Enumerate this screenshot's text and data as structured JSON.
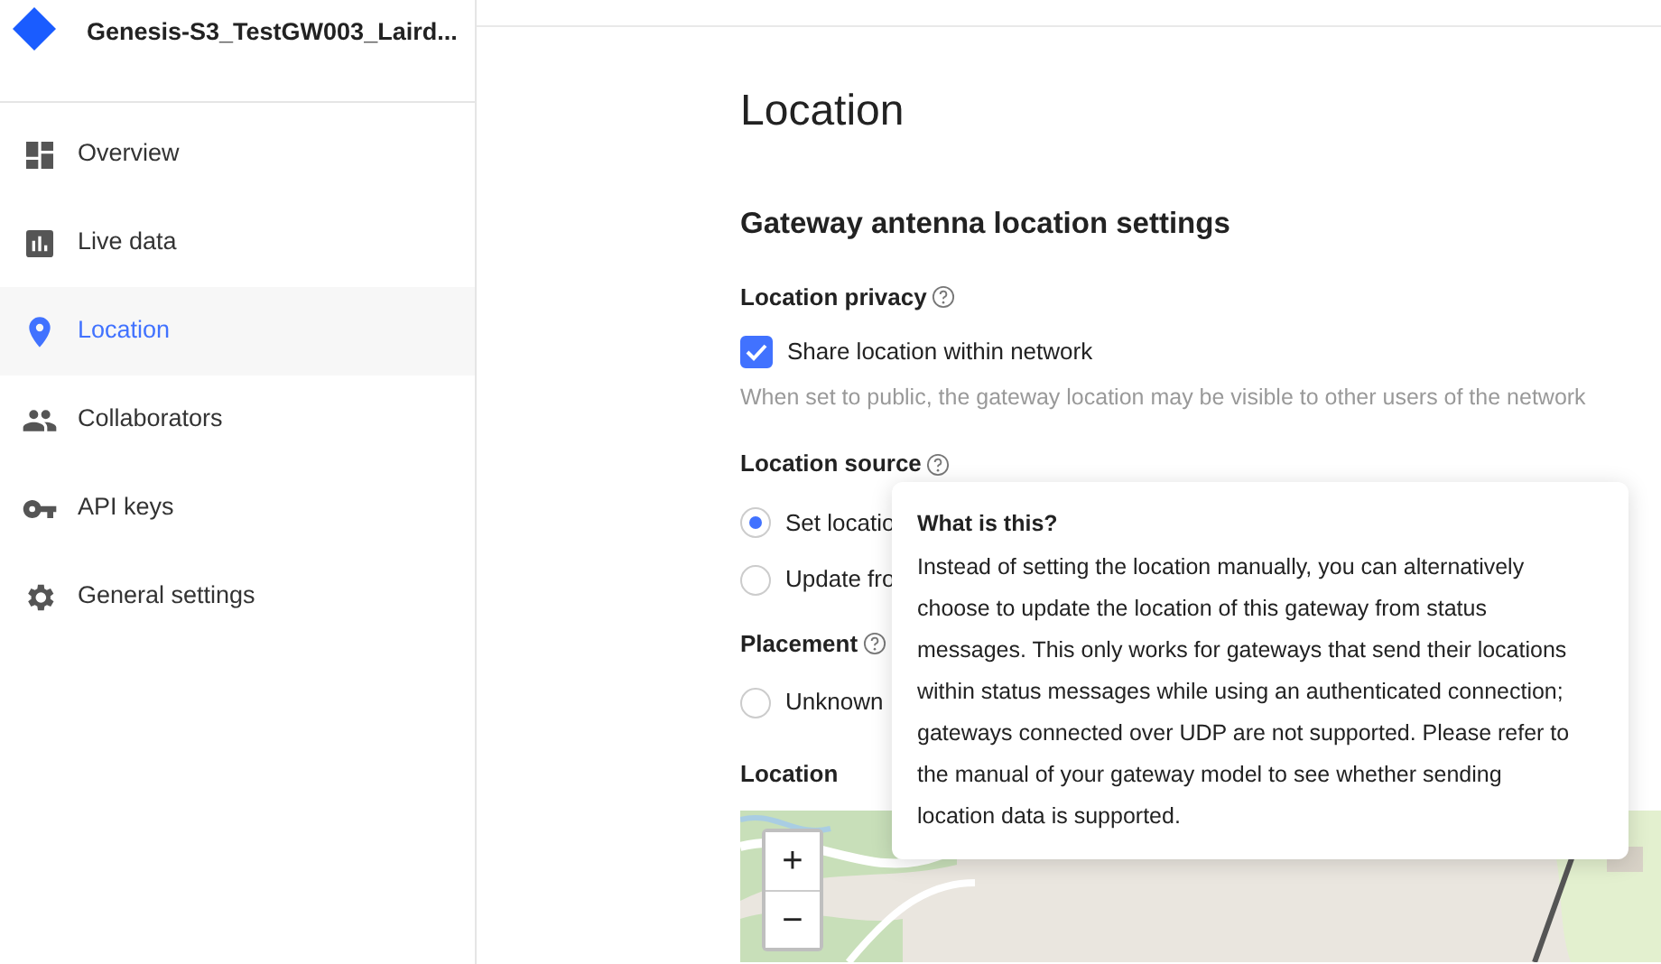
{
  "sidebar": {
    "title": "Genesis-S3_TestGW003_Laird...",
    "items": [
      {
        "label": "Overview",
        "selected": false
      },
      {
        "label": "Live data",
        "selected": false
      },
      {
        "label": "Location",
        "selected": true
      },
      {
        "label": "Collaborators",
        "selected": false
      },
      {
        "label": "API keys",
        "selected": false
      },
      {
        "label": "General settings",
        "selected": false
      }
    ]
  },
  "page_title": "Location",
  "section_title": "Gateway antenna location settings",
  "privacy": {
    "label": "Location privacy",
    "checkbox": {
      "label": "Share location within network",
      "checked": true
    },
    "hint": "When set to public, the gateway location may be visible to other users of the network"
  },
  "source": {
    "label": "Location source",
    "options": [
      {
        "label": "Set locatio",
        "selected": true
      },
      {
        "label": "Update fro",
        "selected": false
      }
    ]
  },
  "placement": {
    "label": "Placement",
    "options": [
      {
        "label": "Unknown",
        "selected": false
      }
    ]
  },
  "location": {
    "label": "Location",
    "map": {
      "kind": "picture",
      "zoom_in": "+",
      "zoom_out": "−"
    }
  },
  "tooltip": {
    "title": "What is this?",
    "text": "Instead of setting the location manually, you can alternatively choose to update the location of this gateway from status messages. This only works for gateways that send their locations within status messages while using an authenticated connection; gateways connected over UDP are not supported. Please refer to the manual of your gateway model to see whether sending location data is supported."
  }
}
